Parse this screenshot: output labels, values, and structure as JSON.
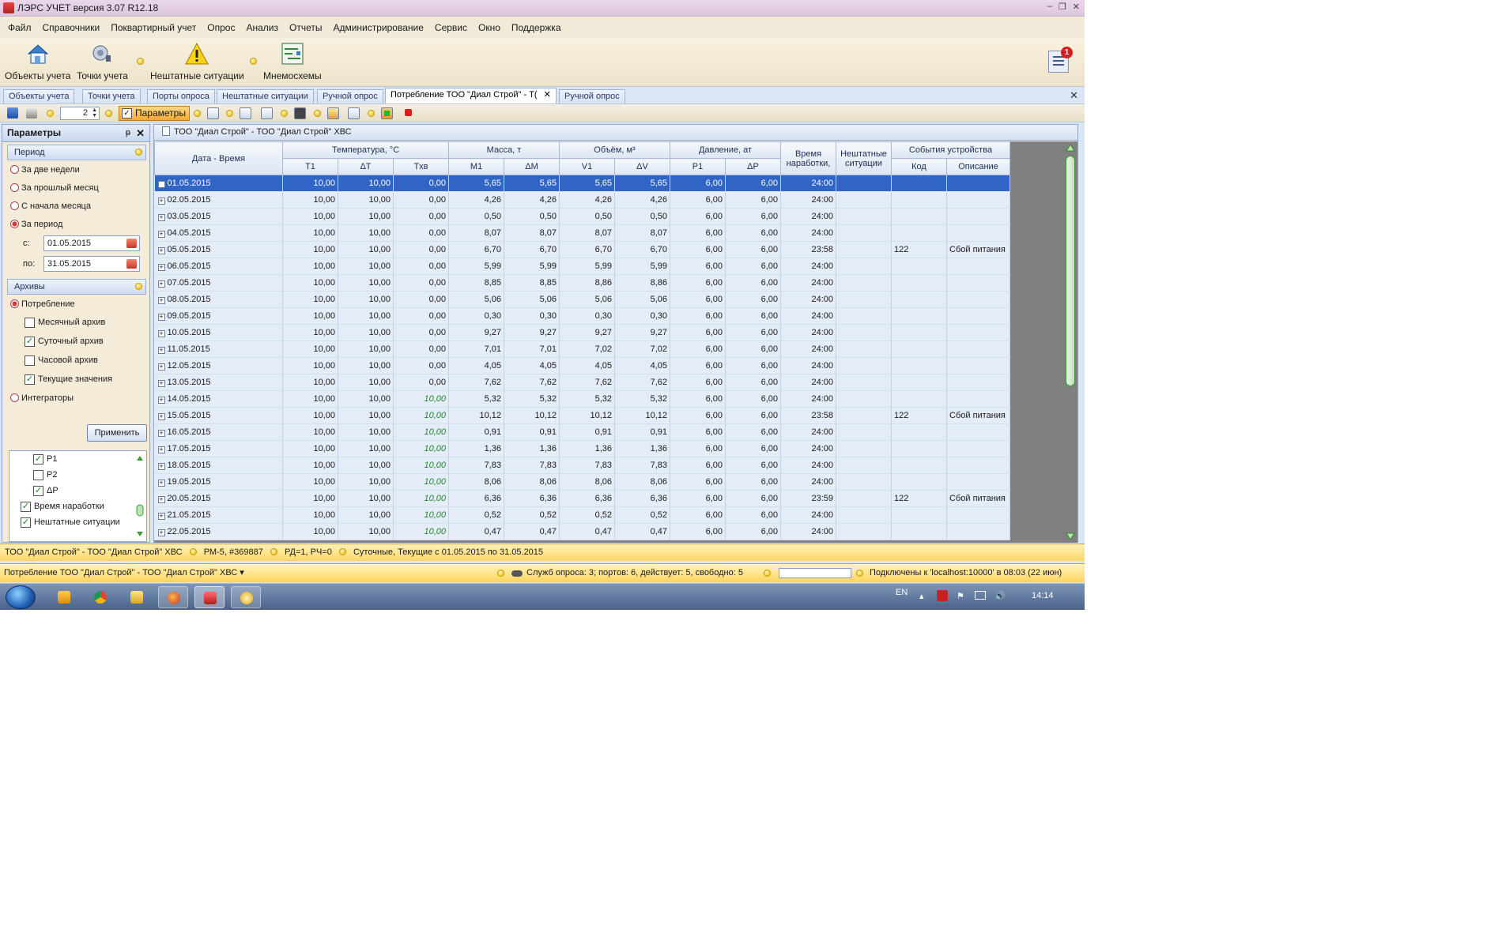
{
  "window": {
    "title": "ЛЭРС УЧЕТ версия 3.07 R12.18",
    "controls": [
      "–",
      "❐",
      "✕"
    ]
  },
  "menu": [
    "Файл",
    "Справочники",
    "Поквартирный учет",
    "Опрос",
    "Анализ",
    "Отчеты",
    "Администрирование",
    "Сервис",
    "Окно",
    "Поддержка"
  ],
  "ribbon": {
    "objects": "Объекты учета",
    "points": "Точки учета",
    "emergencies": "Нештатные ситуации",
    "mnemo": "Мнемосхемы",
    "notification_count": "1"
  },
  "doc_tabs": [
    {
      "label": "Объекты учета"
    },
    {
      "label": "Точки учета"
    },
    {
      "label": "Порты опроса"
    },
    {
      "label": "Нештатные ситуации"
    },
    {
      "label": "Ручной опрос"
    },
    {
      "label": "Потребление ТОО \"Диал Строй\" - Т("
    },
    {
      "label": "Ручной опрос"
    }
  ],
  "tab_close_glyph": "✕",
  "toolbar": {
    "spin_value": "2",
    "params_label": "Параметры"
  },
  "panel": {
    "title": "Параметры",
    "pin": "ᵽ",
    "close": "✕",
    "period_section": "Период",
    "periods": [
      "За две недели",
      "За прошлый месяц",
      "С начала месяца",
      "За период"
    ],
    "from_label": "с:",
    "from_value": "01.05.2015",
    "to_label": "по:",
    "to_value": "31.05.2015",
    "archives_section": "Архивы",
    "consumption": "Потребление",
    "archives": [
      {
        "label": "Месячный архив",
        "checked": false
      },
      {
        "label": "Суточный архив",
        "checked": true
      },
      {
        "label": "Часовой архив",
        "checked": false
      },
      {
        "label": "Текущие значения",
        "checked": true
      }
    ],
    "integrators": "Интеграторы",
    "apply": "Применить",
    "tree": [
      {
        "label": "P1",
        "checked": true,
        "level": 2
      },
      {
        "label": "P2",
        "checked": false,
        "level": 2
      },
      {
        "label": "ΔP",
        "checked": true,
        "level": 2
      },
      {
        "label": "Время наработки",
        "checked": true,
        "level": 1
      },
      {
        "label": "Нештатные ситуации",
        "checked": true,
        "level": 1
      }
    ]
  },
  "grid": {
    "caption": "ТОО \"Диал Строй\" - ТОО \"Диал Строй\"  ХВС",
    "header": {
      "datetime": "Дата - Время",
      "temperature": "Температура, °C",
      "mass": "Масса, т",
      "volume": "Объём, м³",
      "pressure": "Давление, ат",
      "runtime": "Время наработки,",
      "emergency": "Нештатные ситуации",
      "events": "События устройства",
      "t1": "T1",
      "dt": "ΔT",
      "txv": "Tхв",
      "m1": "M1",
      "dm": "ΔM",
      "v1": "V1",
      "dv": "ΔV",
      "p1": "P1",
      "dp": "ΔP",
      "code": "Код",
      "descr": "Описание"
    },
    "rows": [
      [
        "01.05.2015",
        "10,00",
        "10,00",
        "0,00",
        "5,65",
        "5,65",
        "5,65",
        "5,65",
        "6,00",
        "6,00",
        "24:00",
        "",
        "",
        ""
      ],
      [
        "02.05.2015",
        "10,00",
        "10,00",
        "0,00",
        "4,26",
        "4,26",
        "4,26",
        "4,26",
        "6,00",
        "6,00",
        "24:00",
        "",
        "",
        ""
      ],
      [
        "03.05.2015",
        "10,00",
        "10,00",
        "0,00",
        "0,50",
        "0,50",
        "0,50",
        "0,50",
        "6,00",
        "6,00",
        "24:00",
        "",
        "",
        ""
      ],
      [
        "04.05.2015",
        "10,00",
        "10,00",
        "0,00",
        "8,07",
        "8,07",
        "8,07",
        "8,07",
        "6,00",
        "6,00",
        "24:00",
        "",
        "",
        ""
      ],
      [
        "05.05.2015",
        "10,00",
        "10,00",
        "0,00",
        "6,70",
        "6,70",
        "6,70",
        "6,70",
        "6,00",
        "6,00",
        "23:58",
        "",
        "122",
        "Сбой питания"
      ],
      [
        "06.05.2015",
        "10,00",
        "10,00",
        "0,00",
        "5,99",
        "5,99",
        "5,99",
        "5,99",
        "6,00",
        "6,00",
        "24:00",
        "",
        "",
        ""
      ],
      [
        "07.05.2015",
        "10,00",
        "10,00",
        "0,00",
        "8,85",
        "8,85",
        "8,86",
        "8,86",
        "6,00",
        "6,00",
        "24:00",
        "",
        "",
        ""
      ],
      [
        "08.05.2015",
        "10,00",
        "10,00",
        "0,00",
        "5,06",
        "5,06",
        "5,06",
        "5,06",
        "6,00",
        "6,00",
        "24:00",
        "",
        "",
        ""
      ],
      [
        "09.05.2015",
        "10,00",
        "10,00",
        "0,00",
        "0,30",
        "0,30",
        "0,30",
        "0,30",
        "6,00",
        "6,00",
        "24:00",
        "",
        "",
        ""
      ],
      [
        "10.05.2015",
        "10,00",
        "10,00",
        "0,00",
        "9,27",
        "9,27",
        "9,27",
        "9,27",
        "6,00",
        "6,00",
        "24:00",
        "",
        "",
        ""
      ],
      [
        "11.05.2015",
        "10,00",
        "10,00",
        "0,00",
        "7,01",
        "7,01",
        "7,02",
        "7,02",
        "6,00",
        "6,00",
        "24:00",
        "",
        "",
        ""
      ],
      [
        "12.05.2015",
        "10,00",
        "10,00",
        "0,00",
        "4,05",
        "4,05",
        "4,05",
        "4,05",
        "6,00",
        "6,00",
        "24:00",
        "",
        "",
        ""
      ],
      [
        "13.05.2015",
        "10,00",
        "10,00",
        "0,00",
        "7,62",
        "7,62",
        "7,62",
        "7,62",
        "6,00",
        "6,00",
        "24:00",
        "",
        "",
        ""
      ],
      [
        "14.05.2015",
        "10,00",
        "10,00",
        "10,00",
        "5,32",
        "5,32",
        "5,32",
        "5,32",
        "6,00",
        "6,00",
        "24:00",
        "",
        "",
        ""
      ],
      [
        "15.05.2015",
        "10,00",
        "10,00",
        "10,00",
        "10,12",
        "10,12",
        "10,12",
        "10,12",
        "6,00",
        "6,00",
        "23:58",
        "",
        "122",
        "Сбой питания"
      ],
      [
        "16.05.2015",
        "10,00",
        "10,00",
        "10,00",
        "0,91",
        "0,91",
        "0,91",
        "0,91",
        "6,00",
        "6,00",
        "24:00",
        "",
        "",
        ""
      ],
      [
        "17.05.2015",
        "10,00",
        "10,00",
        "10,00",
        "1,36",
        "1,36",
        "1,36",
        "1,36",
        "6,00",
        "6,00",
        "24:00",
        "",
        "",
        ""
      ],
      [
        "18.05.2015",
        "10,00",
        "10,00",
        "10,00",
        "7,83",
        "7,83",
        "7,83",
        "7,83",
        "6,00",
        "6,00",
        "24:00",
        "",
        "",
        ""
      ],
      [
        "19.05.2015",
        "10,00",
        "10,00",
        "10,00",
        "8,06",
        "8,06",
        "8,06",
        "8,06",
        "6,00",
        "6,00",
        "24:00",
        "",
        "",
        ""
      ],
      [
        "20.05.2015",
        "10,00",
        "10,00",
        "10,00",
        "6,36",
        "6,36",
        "6,36",
        "6,36",
        "6,00",
        "6,00",
        "23:59",
        "",
        "122",
        "Сбой питания"
      ],
      [
        "21.05.2015",
        "10,00",
        "10,00",
        "10,00",
        "0,52",
        "0,52",
        "0,52",
        "0,52",
        "6,00",
        "6,00",
        "24:00",
        "",
        "",
        ""
      ],
      [
        "22.05.2015",
        "10,00",
        "10,00",
        "10,00",
        "0,47",
        "0,47",
        "0,47",
        "0,47",
        "6,00",
        "6,00",
        "24:00",
        "",
        "",
        ""
      ]
    ]
  },
  "status1": {
    "object": "ТОО \"Диал Строй\" - ТОО \"Диал Строй\"   ХВС",
    "device": "РМ-5, #369887",
    "flags": "РД=1, РЧ=0",
    "range": "Суточные, Текущие с 01.05.2015 по 31.05.2015"
  },
  "status2": {
    "left": "Потребление ТОО \"Диал Строй\" - ТОО \"Диал Строй\"   ХВС ▾",
    "services": "Служб опроса: 3; портов: 6, действует: 5, свободно: 5",
    "connection": "Подключены к 'localhost:10000' в 08:03 (22 июн)"
  },
  "taskbar": {
    "lang": "EN",
    "time": "14:14"
  }
}
